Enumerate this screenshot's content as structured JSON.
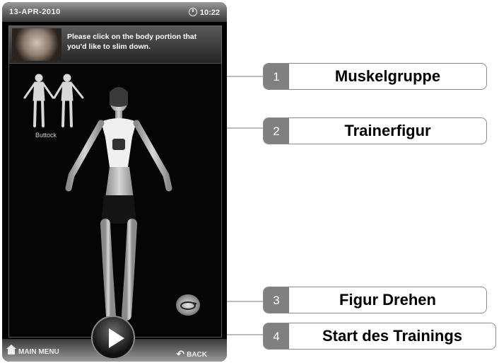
{
  "device": {
    "date": "13-APR-2010",
    "time": "10:22",
    "instruction": "Please click on the body portion that you'd like to slim down.",
    "muscle_group_label": "Buttock",
    "main_menu_label": "MAIN MENU",
    "back_label": "BACK"
  },
  "callouts": [
    {
      "number": "1",
      "label": "Muskelgruppe"
    },
    {
      "number": "2",
      "label": "Trainerfigur"
    },
    {
      "number": "3",
      "label": "Figur Drehen"
    },
    {
      "number": "4",
      "label": "Start des Trainings"
    }
  ],
  "colors": {
    "number_box": "#808080",
    "callout_border": "#8a8a8a",
    "screen_background": "#000000"
  }
}
